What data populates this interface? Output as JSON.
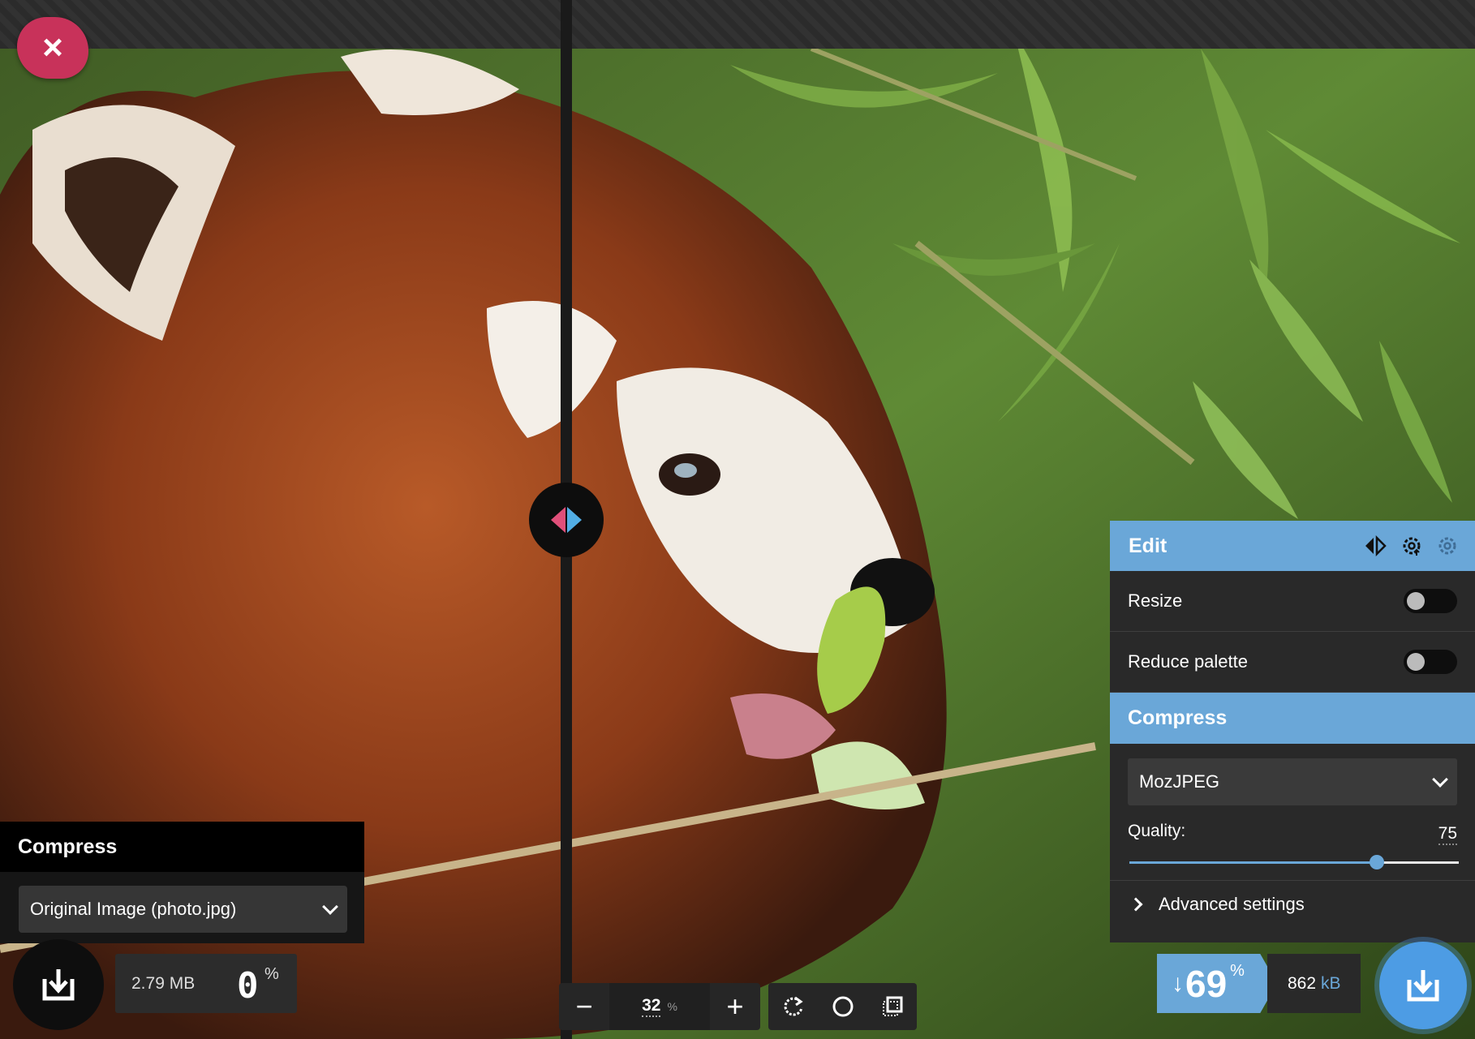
{
  "app": {
    "close_label": "×"
  },
  "left": {
    "title": "Compress",
    "source_select": "Original Image (photo.jpg)",
    "size": "2.79 MB",
    "percent": "0",
    "percent_unit": "%"
  },
  "zoom": {
    "value": "32",
    "unit": "%",
    "minus": "−",
    "plus": "+"
  },
  "right": {
    "edit_title": "Edit",
    "resize_label": "Resize",
    "resize_enabled": false,
    "palette_label": "Reduce palette",
    "palette_enabled": false,
    "compress_title": "Compress",
    "codec": "MozJPEG",
    "quality_label": "Quality:",
    "quality_value": "75",
    "quality_fraction": 0.75,
    "advanced_label": "Advanced settings"
  },
  "result": {
    "arrow": "↓",
    "reduction": "69",
    "reduction_unit": "%",
    "size": "862",
    "size_unit": "kB"
  },
  "icons": {
    "close": "close-icon",
    "split": "split-view-icon",
    "download": "download-icon",
    "rotate": "rotate-icon",
    "background": "circle-icon",
    "crop": "crop-icon",
    "settings": "gear-icon"
  },
  "colors": {
    "accent": "#6aa7d8",
    "close": "#c8325a",
    "split_left": "#e0507a",
    "split_right": "#52aee5"
  }
}
